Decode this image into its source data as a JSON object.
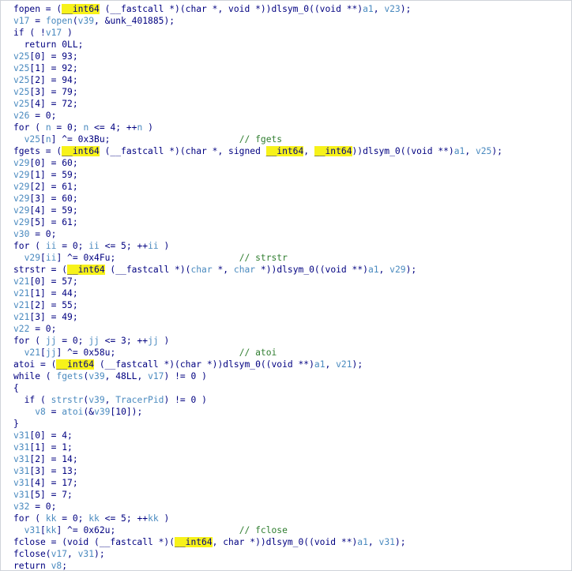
{
  "code_lines": [
    [
      {
        "t": "fopen = (",
        "k": "func"
      },
      {
        "t": "__int64",
        "k": "highlight"
      },
      {
        "t": " (__fastcall *)(char *, void *))dlsym_0((void **)",
        "k": "kw"
      },
      {
        "t": "a1",
        "k": "var"
      },
      {
        "t": ", ",
        "k": "punct"
      },
      {
        "t": "v23",
        "k": "var"
      },
      {
        "t": ");",
        "k": "punct"
      }
    ],
    [
      {
        "t": "v17",
        "k": "var"
      },
      {
        "t": " = ",
        "k": "punct"
      },
      {
        "t": "fopen",
        "k": "var"
      },
      {
        "t": "(",
        "k": "punct"
      },
      {
        "t": "v39",
        "k": "var"
      },
      {
        "t": ", &unk_401885);",
        "k": "punct"
      }
    ],
    [
      {
        "t": "if ( !",
        "k": "kw"
      },
      {
        "t": "v17",
        "k": "var"
      },
      {
        "t": " )",
        "k": "punct"
      }
    ],
    [
      {
        "t": "  return 0LL;",
        "k": "kw"
      }
    ],
    [
      {
        "t": "v25",
        "k": "var"
      },
      {
        "t": "[0] = 93;",
        "k": "num"
      }
    ],
    [
      {
        "t": "v25",
        "k": "var"
      },
      {
        "t": "[1] = 92;",
        "k": "num"
      }
    ],
    [
      {
        "t": "v25",
        "k": "var"
      },
      {
        "t": "[2] = 94;",
        "k": "num"
      }
    ],
    [
      {
        "t": "v25",
        "k": "var"
      },
      {
        "t": "[3] = 79;",
        "k": "num"
      }
    ],
    [
      {
        "t": "v25",
        "k": "var"
      },
      {
        "t": "[4] = 72;",
        "k": "num"
      }
    ],
    [
      {
        "t": "v26",
        "k": "var"
      },
      {
        "t": " = 0;",
        "k": "num"
      }
    ],
    [
      {
        "t": "for ( ",
        "k": "kw"
      },
      {
        "t": "n",
        "k": "var"
      },
      {
        "t": " = 0; ",
        "k": "num"
      },
      {
        "t": "n",
        "k": "var"
      },
      {
        "t": " <= 4; ++",
        "k": "num"
      },
      {
        "t": "n",
        "k": "var"
      },
      {
        "t": " )",
        "k": "punct"
      }
    ],
    [
      {
        "t": "  ",
        "k": "punct"
      },
      {
        "t": "v25",
        "k": "var"
      },
      {
        "t": "[",
        "k": "punct"
      },
      {
        "t": "n",
        "k": "var"
      },
      {
        "t": "] ^= 0x3Bu;",
        "k": "num"
      },
      {
        "t": "                        ",
        "k": "punct"
      },
      {
        "t": "// fgets",
        "k": "comment"
      }
    ],
    [
      {
        "t": "fgets = (",
        "k": "func"
      },
      {
        "t": "__int64",
        "k": "highlight"
      },
      {
        "t": " (__fastcall *)(char *, signed ",
        "k": "kw"
      },
      {
        "t": "__int64",
        "k": "highlight"
      },
      {
        "t": ", ",
        "k": "punct"
      },
      {
        "t": "__int64",
        "k": "highlight"
      },
      {
        "t": "))dlsym_0((void **)",
        "k": "kw"
      },
      {
        "t": "a1",
        "k": "var"
      },
      {
        "t": ", ",
        "k": "punct"
      },
      {
        "t": "v25",
        "k": "var"
      },
      {
        "t": ");",
        "k": "punct"
      }
    ],
    [
      {
        "t": "v29",
        "k": "var"
      },
      {
        "t": "[0] = 60;",
        "k": "num"
      }
    ],
    [
      {
        "t": "v29",
        "k": "var"
      },
      {
        "t": "[1] = 59;",
        "k": "num"
      }
    ],
    [
      {
        "t": "v29",
        "k": "var"
      },
      {
        "t": "[2] = 61;",
        "k": "num"
      }
    ],
    [
      {
        "t": "v29",
        "k": "var"
      },
      {
        "t": "[3] = 60;",
        "k": "num"
      }
    ],
    [
      {
        "t": "v29",
        "k": "var"
      },
      {
        "t": "[4] = 59;",
        "k": "num"
      }
    ],
    [
      {
        "t": "v29",
        "k": "var"
      },
      {
        "t": "[5] = 61;",
        "k": "num"
      }
    ],
    [
      {
        "t": "v30",
        "k": "var"
      },
      {
        "t": " = 0;",
        "k": "num"
      }
    ],
    [
      {
        "t": "for ( ",
        "k": "kw"
      },
      {
        "t": "ii",
        "k": "var"
      },
      {
        "t": " = 0; ",
        "k": "num"
      },
      {
        "t": "ii",
        "k": "var"
      },
      {
        "t": " <= 5; ++",
        "k": "num"
      },
      {
        "t": "ii",
        "k": "var"
      },
      {
        "t": " )",
        "k": "punct"
      }
    ],
    [
      {
        "t": "  ",
        "k": "punct"
      },
      {
        "t": "v29",
        "k": "var"
      },
      {
        "t": "[",
        "k": "punct"
      },
      {
        "t": "ii",
        "k": "var"
      },
      {
        "t": "] ^= 0x4Fu;",
        "k": "num"
      },
      {
        "t": "                       ",
        "k": "punct"
      },
      {
        "t": "// strstr",
        "k": "comment"
      }
    ],
    [
      {
        "t": "strstr = (",
        "k": "func"
      },
      {
        "t": "__int64",
        "k": "highlight"
      },
      {
        "t": " (__fastcall *)(",
        "k": "kw"
      },
      {
        "t": "char",
        "k": "var"
      },
      {
        "t": " *, ",
        "k": "punct"
      },
      {
        "t": "char",
        "k": "var"
      },
      {
        "t": " *))dlsym_0((void **)",
        "k": "kw"
      },
      {
        "t": "a1",
        "k": "var"
      },
      {
        "t": ", ",
        "k": "punct"
      },
      {
        "t": "v29",
        "k": "var"
      },
      {
        "t": ");",
        "k": "punct"
      }
    ],
    [
      {
        "t": "v21",
        "k": "var"
      },
      {
        "t": "[0] = 57;",
        "k": "num"
      }
    ],
    [
      {
        "t": "v21",
        "k": "var"
      },
      {
        "t": "[1] = 44;",
        "k": "num"
      }
    ],
    [
      {
        "t": "v21",
        "k": "var"
      },
      {
        "t": "[2] = 55;",
        "k": "num"
      }
    ],
    [
      {
        "t": "v21",
        "k": "var"
      },
      {
        "t": "[3] = 49;",
        "k": "num"
      }
    ],
    [
      {
        "t": "v22",
        "k": "var"
      },
      {
        "t": " = 0;",
        "k": "num"
      }
    ],
    [
      {
        "t": "for ( ",
        "k": "kw"
      },
      {
        "t": "jj",
        "k": "var"
      },
      {
        "t": " = 0; ",
        "k": "num"
      },
      {
        "t": "jj",
        "k": "var"
      },
      {
        "t": " <= 3; ++",
        "k": "num"
      },
      {
        "t": "jj",
        "k": "var"
      },
      {
        "t": " )",
        "k": "punct"
      }
    ],
    [
      {
        "t": "  ",
        "k": "punct"
      },
      {
        "t": "v21",
        "k": "var"
      },
      {
        "t": "[",
        "k": "punct"
      },
      {
        "t": "jj",
        "k": "var"
      },
      {
        "t": "] ^= 0x58u;",
        "k": "num"
      },
      {
        "t": "                       ",
        "k": "punct"
      },
      {
        "t": "// atoi",
        "k": "comment"
      }
    ],
    [
      {
        "t": "atoi = (",
        "k": "func"
      },
      {
        "t": "__int64",
        "k": "highlight"
      },
      {
        "t": " (__fastcall *)(char *))dlsym_0((void **)",
        "k": "kw"
      },
      {
        "t": "a1",
        "k": "var"
      },
      {
        "t": ", ",
        "k": "punct"
      },
      {
        "t": "v21",
        "k": "var"
      },
      {
        "t": ");",
        "k": "punct"
      }
    ],
    [
      {
        "t": "while ( ",
        "k": "kw"
      },
      {
        "t": "fgets",
        "k": "var"
      },
      {
        "t": "(",
        "k": "punct"
      },
      {
        "t": "v39",
        "k": "var"
      },
      {
        "t": ", 48LL, ",
        "k": "num"
      },
      {
        "t": "v17",
        "k": "var"
      },
      {
        "t": ") != 0 )",
        "k": "punct"
      }
    ],
    [
      {
        "t": "{",
        "k": "punct"
      }
    ],
    [
      {
        "t": "  if ( ",
        "k": "kw"
      },
      {
        "t": "strstr",
        "k": "var"
      },
      {
        "t": "(",
        "k": "punct"
      },
      {
        "t": "v39",
        "k": "var"
      },
      {
        "t": ", ",
        "k": "punct"
      },
      {
        "t": "TracerPid",
        "k": "var"
      },
      {
        "t": ") != 0 )",
        "k": "punct"
      }
    ],
    [
      {
        "t": "    ",
        "k": "punct"
      },
      {
        "t": "v8",
        "k": "var"
      },
      {
        "t": " = ",
        "k": "punct"
      },
      {
        "t": "atoi",
        "k": "var"
      },
      {
        "t": "(&",
        "k": "punct"
      },
      {
        "t": "v39",
        "k": "var"
      },
      {
        "t": "[10]);",
        "k": "num"
      }
    ],
    [
      {
        "t": "}",
        "k": "punct"
      }
    ],
    [
      {
        "t": "v31",
        "k": "var"
      },
      {
        "t": "[0] = 4;",
        "k": "num"
      }
    ],
    [
      {
        "t": "v31",
        "k": "var"
      },
      {
        "t": "[1] = 1;",
        "k": "num"
      }
    ],
    [
      {
        "t": "v31",
        "k": "var"
      },
      {
        "t": "[2] = 14;",
        "k": "num"
      }
    ],
    [
      {
        "t": "v31",
        "k": "var"
      },
      {
        "t": "[3] = 13;",
        "k": "num"
      }
    ],
    [
      {
        "t": "v31",
        "k": "var"
      },
      {
        "t": "[4] = 17;",
        "k": "num"
      }
    ],
    [
      {
        "t": "v31",
        "k": "var"
      },
      {
        "t": "[5] = 7;",
        "k": "num"
      }
    ],
    [
      {
        "t": "v32",
        "k": "var"
      },
      {
        "t": " = 0;",
        "k": "num"
      }
    ],
    [
      {
        "t": "for ( ",
        "k": "kw"
      },
      {
        "t": "kk",
        "k": "var"
      },
      {
        "t": " = 0; ",
        "k": "num"
      },
      {
        "t": "kk",
        "k": "var"
      },
      {
        "t": " <= 5; ++",
        "k": "num"
      },
      {
        "t": "kk",
        "k": "var"
      },
      {
        "t": " )",
        "k": "punct"
      }
    ],
    [
      {
        "t": "  ",
        "k": "punct"
      },
      {
        "t": "v31",
        "k": "var"
      },
      {
        "t": "[",
        "k": "punct"
      },
      {
        "t": "kk",
        "k": "var"
      },
      {
        "t": "] ^= 0x62u;",
        "k": "num"
      },
      {
        "t": "                       ",
        "k": "punct"
      },
      {
        "t": "// fclose",
        "k": "comment"
      }
    ],
    [
      {
        "t": "fclose = (void (__fastcall *)(",
        "k": "func"
      },
      {
        "t": "__int64",
        "k": "highlight"
      },
      {
        "t": ", char *))dlsym_0((void **)",
        "k": "kw"
      },
      {
        "t": "a1",
        "k": "var"
      },
      {
        "t": ", ",
        "k": "punct"
      },
      {
        "t": "v31",
        "k": "var"
      },
      {
        "t": ");",
        "k": "punct"
      }
    ],
    [
      {
        "t": "fclose(",
        "k": "func"
      },
      {
        "t": "v17",
        "k": "var"
      },
      {
        "t": ", ",
        "k": "punct"
      },
      {
        "t": "v31",
        "k": "var"
      },
      {
        "t": ");",
        "k": "punct"
      }
    ],
    [
      {
        "t": "return ",
        "k": "kw"
      },
      {
        "t": "v8",
        "k": "var"
      },
      {
        "t": ";",
        "k": "punct"
      }
    ]
  ]
}
